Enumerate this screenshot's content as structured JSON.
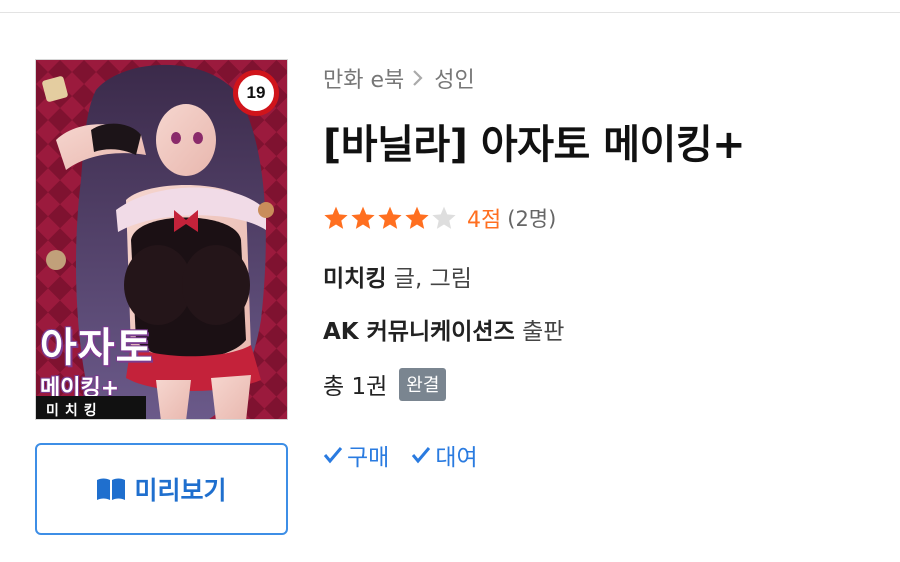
{
  "breadcrumb": {
    "category": "만화 e북",
    "subcategory": "성인"
  },
  "book": {
    "title": "[바닐라] 아자토 메이킹+",
    "rating": {
      "stars_filled": 4,
      "stars_total": 5,
      "score_text": "4점",
      "count_text": "(2명)"
    },
    "author": {
      "name": "미치킹",
      "role": "글, 그림"
    },
    "publisher": {
      "name": "AK 커뮤니케이션즈",
      "role": "출판"
    },
    "volume": {
      "text": "총 1권",
      "status_badge": "완결"
    }
  },
  "cover": {
    "title_text": "아자토",
    "subtitle_text": "메이킹+",
    "author_text": "미치킹",
    "age_rating": "19"
  },
  "actions": {
    "preview_label": "미리보기",
    "purchase_label": "구매",
    "rent_label": "대여"
  },
  "colors": {
    "accent_blue": "#1f6fce",
    "star_orange": "#ff6f20",
    "badge_gray": "#7a8590",
    "cover_bg": "#8e1838"
  },
  "icons": {
    "breadcrumb_separator": "chevron-right-icon",
    "preview": "open-book-icon",
    "option_check": "check-icon",
    "star": "star-icon"
  }
}
